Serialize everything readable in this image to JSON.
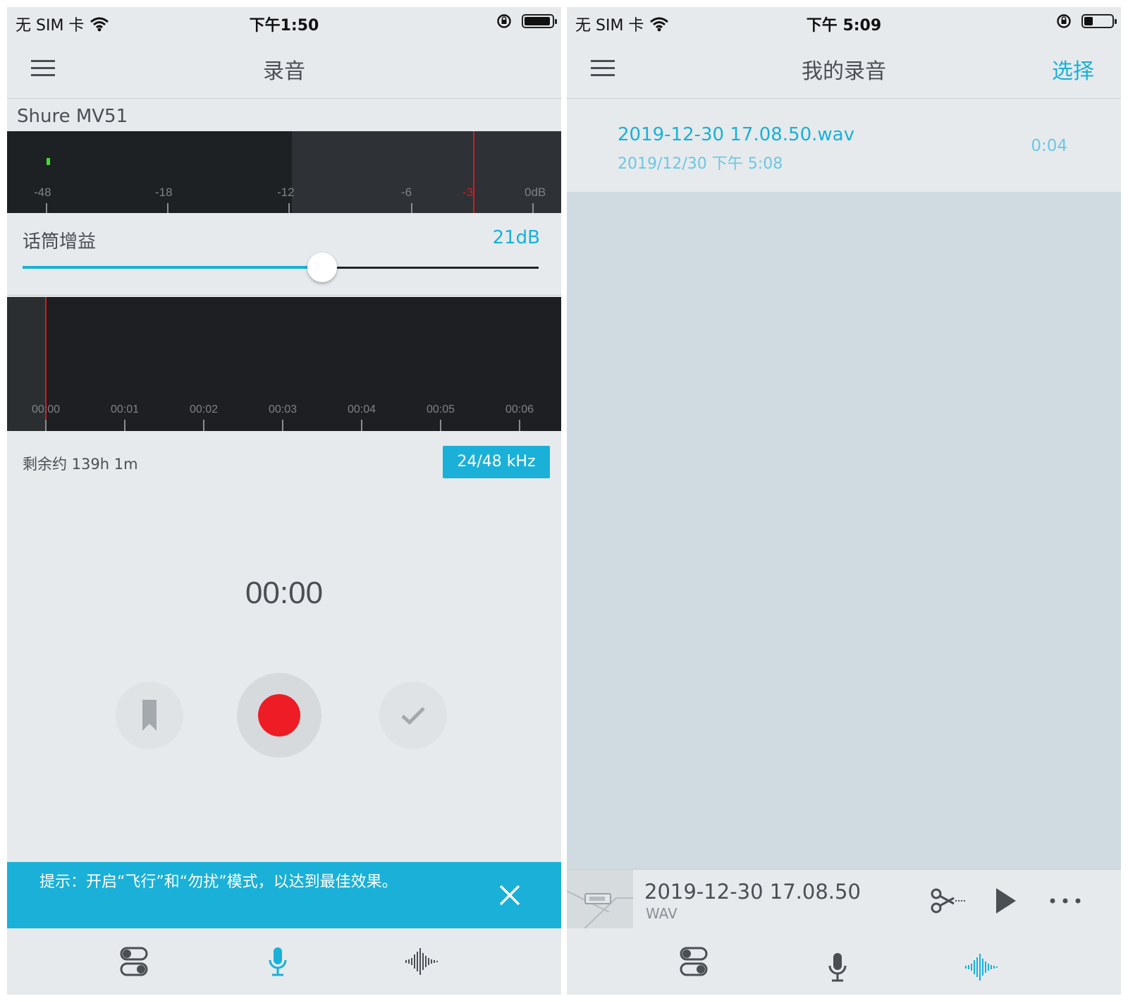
{
  "left": {
    "status": {
      "carrier": "无 SIM 卡",
      "time": "下午1:50",
      "battery_level": 0.85
    },
    "nav": {
      "title": "录音"
    },
    "device_name": "Shure MV51",
    "meter": {
      "labels": [
        "-48",
        "-18",
        "-12",
        "-6",
        "-3",
        "0dB"
      ]
    },
    "gain": {
      "label": "话筒增益",
      "value": "21dB",
      "level": 0.58
    },
    "timeline": {
      "labels": [
        "00:00",
        "00:01",
        "00:02",
        "00:03",
        "00:04",
        "00:05",
        "00:06"
      ]
    },
    "remaining": "剩余约 139h 1m",
    "sample_rate": "24/48 kHz",
    "timer": "00:00",
    "tip": "提示：开启“飞行”和“勿扰”模式，以达到最佳效果。",
    "active_tab": "record"
  },
  "right": {
    "status": {
      "carrier": "无 SIM 卡",
      "time": "下午 5:09",
      "battery_level": 0.3
    },
    "nav": {
      "title": "我的录音",
      "select_label": "选择"
    },
    "recordings": [
      {
        "name": "2019-12-30 17.08.50.wav",
        "date": "2019/12/30 下午 5:08",
        "duration": "0:04"
      }
    ],
    "player": {
      "title": "2019-12-30 17.08.50",
      "format": "WAV"
    },
    "active_tab": "recordings"
  },
  "colors": {
    "accent": "#1ab0d8",
    "record": "#ee1c25",
    "meter_bg": "#1d2023"
  },
  "icons": [
    "wifi-icon",
    "rotation-lock-icon",
    "battery-icon",
    "menu-icon",
    "bookmark-icon",
    "record-icon",
    "check-icon",
    "close-icon",
    "settings-toggle-icon",
    "microphone-icon",
    "waveform-icon",
    "scissors-icon",
    "play-icon",
    "more-icon"
  ]
}
